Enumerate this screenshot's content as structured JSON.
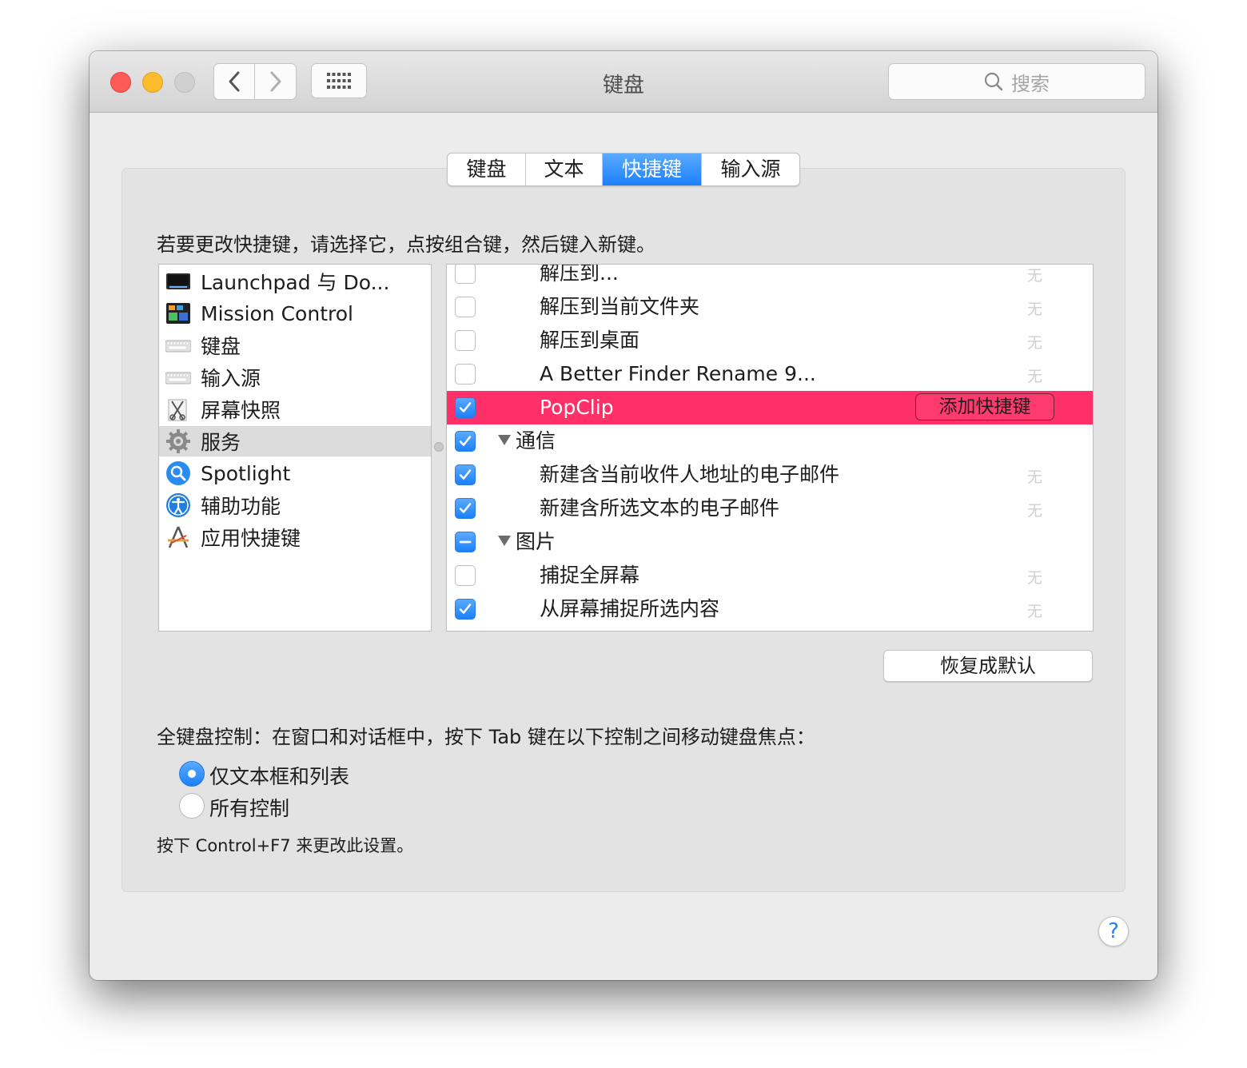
{
  "window": {
    "title": "键盘"
  },
  "search": {
    "placeholder": "搜索"
  },
  "tabs": [
    {
      "label": "键盘",
      "active": false
    },
    {
      "label": "文本",
      "active": false
    },
    {
      "label": "快捷键",
      "active": true
    },
    {
      "label": "输入源",
      "active": false
    }
  ],
  "instruction": "若要更改快捷键，请选择它，点按组合键，然后键入新键。",
  "categories": [
    {
      "label": "Launchpad 与 Do...",
      "icon": "launchpad-icon"
    },
    {
      "label": "Mission Control",
      "icon": "mission-control-icon"
    },
    {
      "label": "键盘",
      "icon": "keyboard-icon"
    },
    {
      "label": "输入源",
      "icon": "input-source-icon"
    },
    {
      "label": "屏幕快照",
      "icon": "screenshot-icon"
    },
    {
      "label": "服务",
      "icon": "gear-icon",
      "selected": true
    },
    {
      "label": "Spotlight",
      "icon": "spotlight-icon"
    },
    {
      "label": "辅助功能",
      "icon": "accessibility-icon"
    },
    {
      "label": "应用快捷键",
      "icon": "app-shortcuts-icon"
    }
  ],
  "shortcuts": [
    {
      "label": "解压到...",
      "state": "off",
      "shortcut": "无",
      "indent": true
    },
    {
      "label": "解压到当前文件夹",
      "state": "off",
      "shortcut": "无",
      "indent": true
    },
    {
      "label": "解压到桌面",
      "state": "off",
      "shortcut": "无",
      "indent": true
    },
    {
      "label": "A Better Finder Rename 9...",
      "state": "off",
      "shortcut": "无",
      "indent": true
    },
    {
      "label": "PopClip",
      "state": "on",
      "shortcut": "",
      "indent": true,
      "highlighted": true,
      "button": "添加快捷键"
    },
    {
      "label": "通信",
      "state": "on",
      "shortcut": "",
      "group": true
    },
    {
      "label": "新建含当前收件人地址的电子邮件",
      "state": "on",
      "shortcut": "无",
      "indent": true
    },
    {
      "label": "新建含所选文本的电子邮件",
      "state": "on",
      "shortcut": "无",
      "indent": true
    },
    {
      "label": "图片",
      "state": "mixed",
      "shortcut": "",
      "group": true
    },
    {
      "label": "捕捉全屏幕",
      "state": "off",
      "shortcut": "无",
      "indent": true
    },
    {
      "label": "从屏幕捕捉所选内容",
      "state": "on",
      "shortcut": "无",
      "indent": true
    }
  ],
  "restore_button": "恢复成默认",
  "full_keyboard": {
    "label": "全键盘控制：在窗口和对话框中，按下 Tab 键在以下控制之间移动键盘焦点：",
    "options": [
      {
        "label": "仅文本框和列表",
        "selected": true
      },
      {
        "label": "所有控制",
        "selected": false
      }
    ],
    "hint": "按下 Control+F7 来更改此设置。"
  },
  "help_label": "?",
  "colors": {
    "accent": "#1c80fb",
    "highlight": "#fe3067"
  }
}
